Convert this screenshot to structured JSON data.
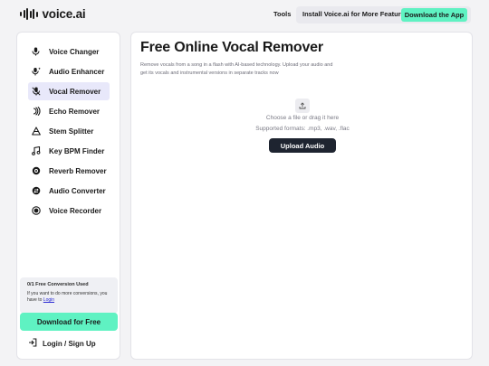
{
  "header": {
    "logo_text": "voice.ai",
    "tools_label": "Tools",
    "install_label": "Install Voice.ai for More Features",
    "download_app_label": "Download the App"
  },
  "sidebar": {
    "items": [
      {
        "label": "Voice Changer",
        "icon": "microphone-icon",
        "active": false
      },
      {
        "label": "Audio Enhancer",
        "icon": "microphone-sparkle-icon",
        "active": false
      },
      {
        "label": "Vocal Remover",
        "icon": "microphone-off-icon",
        "active": true
      },
      {
        "label": "Echo Remover",
        "icon": "echo-icon",
        "active": false
      },
      {
        "label": "Stem Splitter",
        "icon": "triangle-split-icon",
        "active": false
      },
      {
        "label": "Key BPM Finder",
        "icon": "music-note-icon",
        "active": false
      },
      {
        "label": "Reverb Remover",
        "icon": "reverb-icon",
        "active": false
      },
      {
        "label": "Audio Converter",
        "icon": "convert-icon",
        "active": false
      },
      {
        "label": "Voice Recorder",
        "icon": "record-icon",
        "active": false
      }
    ],
    "conversion": {
      "title": "0/1 Free Conversion Used",
      "text": "If you want to do more conversions, you have to",
      "link": "Login"
    },
    "download_free_label": "Download for Free",
    "login_label": "Login / Sign Up"
  },
  "main": {
    "title": "Free Online Vocal Remover",
    "description": "Remove vocals from a song in a flash with AI-based technology. Upload your audio and get its vocals and instrumental versions in separate tracks now",
    "choose_text": "Choose a file or drag it here",
    "formats_text": "Supported formats: .mp3, .wav, .flac",
    "upload_label": "Upload Audio"
  },
  "colors": {
    "accent": "#5ff2c2",
    "active_bg": "#e8e8fa",
    "upload_button": "#1e2430"
  }
}
